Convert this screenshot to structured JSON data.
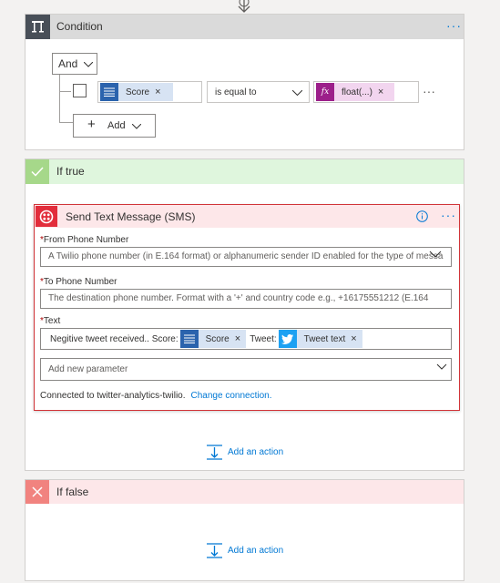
{
  "condition": {
    "title": "Condition",
    "logic": "And",
    "row": {
      "left_token": "Score",
      "operator": "is equal to",
      "right_token": "float(...)"
    },
    "add_label": "Add"
  },
  "if_true": {
    "title": "If true",
    "action": {
      "title": "Send Text Message (SMS)",
      "from": {
        "label": "From Phone Number",
        "placeholder": "A Twilio phone number (in E.164 format) or alphanumeric sender ID enabled for the type of messa"
      },
      "to": {
        "label": "To Phone Number",
        "placeholder": "The destination phone number. Format with a '+' and country code e.g., +16175551212 (E.164"
      },
      "text": {
        "label": "Text",
        "prefix": "Negitive tweet received.. Score:",
        "token1": "Score",
        "mid": "Tweet:",
        "token2": "Tweet text"
      },
      "add_param_placeholder": "Add new parameter",
      "connected_text": "Connected to twitter-analytics-twilio.",
      "change_connection": "Change connection."
    },
    "add_action": "Add an action"
  },
  "if_false": {
    "title": "If false",
    "add_action": "Add an action"
  },
  "colors": {
    "accent": "#0078d4",
    "error_border": "#d13438",
    "true_head": "#dff6dd",
    "false_head": "#fde7e9"
  }
}
